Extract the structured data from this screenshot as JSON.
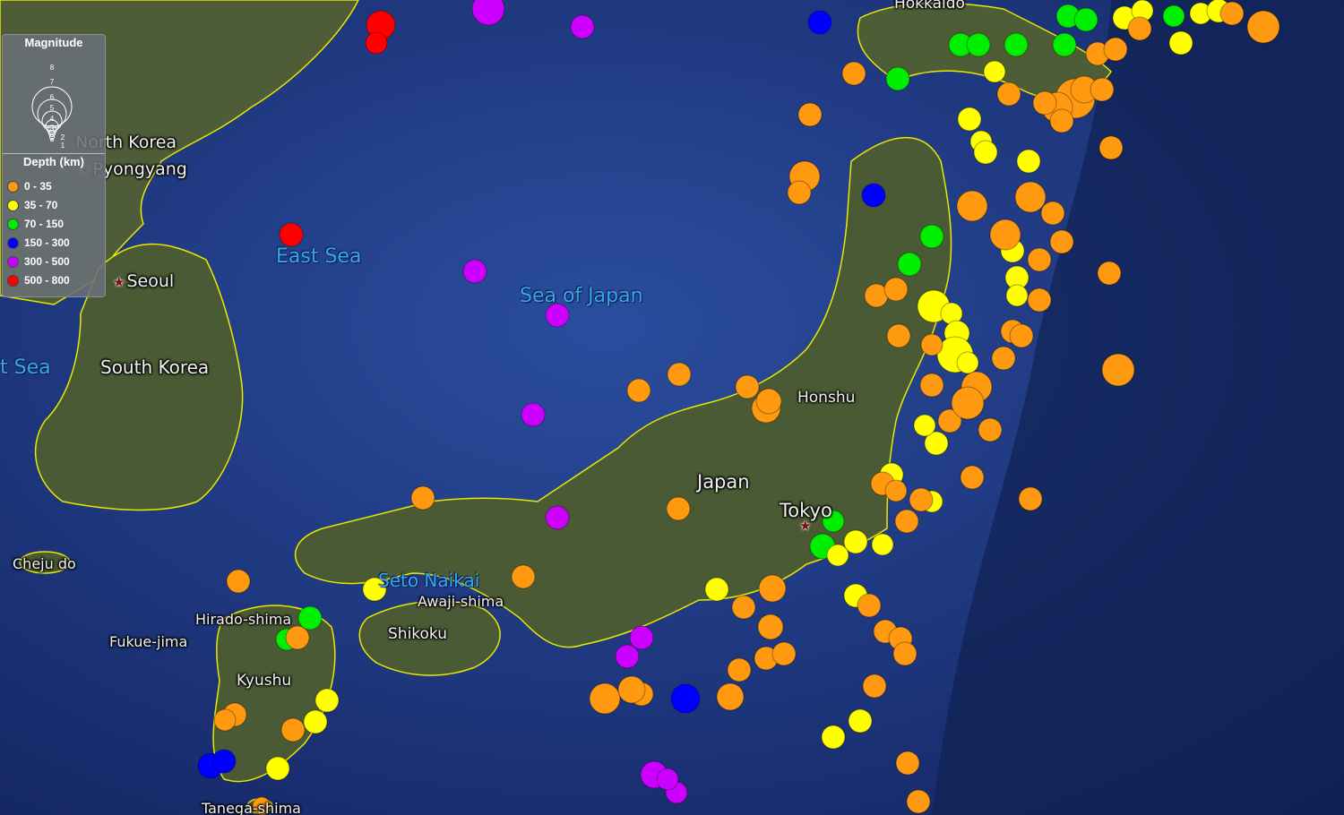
{
  "map": {
    "labels": {
      "north_korea": "North Korea",
      "pyongyang": "Pyongyang",
      "seoul": "Seoul",
      "south_korea": "South Korea",
      "east_sea": "East Sea",
      "sea_of_japan": "Sea of Japan",
      "yellow_sea_fragment": "t Sea",
      "hokkaido": "Hokkaido",
      "honshu": "Honshu",
      "japan": "Japan",
      "tokyo": "Tokyo",
      "seto_naikai": "Seto Naikai",
      "awaji_shima": "Awaji-shima",
      "shikoku": "Shikoku",
      "kyushu": "Kyushu",
      "hirado_shima": "Hirado-shima",
      "fukue_jima": "Fukue-jima",
      "cheju_do": "Cheju do",
      "tanega_shima": "Tanega-shima"
    },
    "colors": {
      "sea": "#1e3a8a",
      "land": "#4a5a34",
      "border": "#f0f000"
    }
  },
  "legend": {
    "magnitude_title": "Magnitude",
    "magnitude_scale": [
      "1",
      "2",
      "3",
      "4",
      "5",
      "6",
      "7",
      "8"
    ],
    "depth_title": "Depth (km)",
    "depth_classes": [
      {
        "label": "0 - 35",
        "color": "#ff9a10"
      },
      {
        "label": "35 - 70",
        "color": "#ffff00"
      },
      {
        "label": "70 - 150",
        "color": "#00ee00"
      },
      {
        "label": "150 - 300",
        "color": "#0000ff"
      },
      {
        "label": "300 - 500",
        "color": "#cc00ff"
      },
      {
        "label": "500 - 800",
        "color": "#ff0000"
      }
    ]
  }
}
